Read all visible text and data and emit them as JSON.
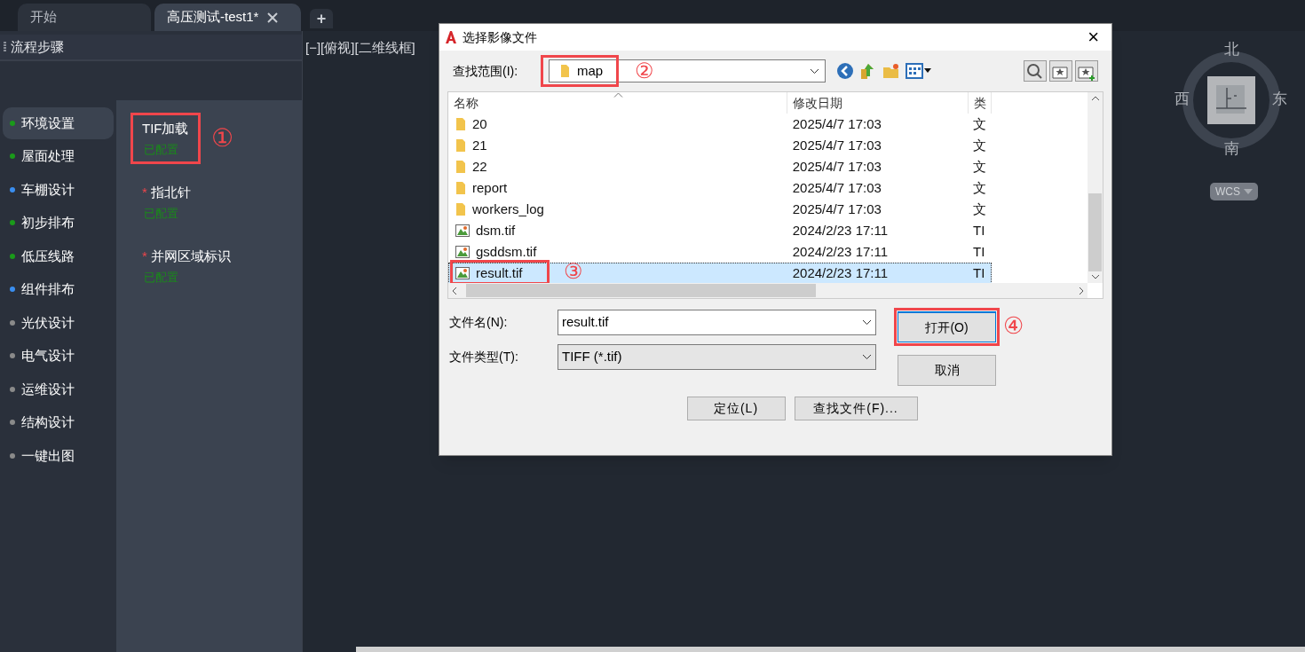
{
  "tabs": [
    {
      "label": "开始",
      "selected": false,
      "closable": false
    },
    {
      "label": "高压测试-test1*",
      "selected": true,
      "closable": true
    }
  ],
  "new_tab": "+",
  "panel": {
    "title": "流程步骤",
    "steps": [
      {
        "label": "环境设置",
        "color": "#1a9a1a",
        "selected": true
      },
      {
        "label": "屋面处理",
        "color": "#1a9a1a",
        "selected": false
      },
      {
        "label": "车棚设计",
        "color": "#3a8ef0",
        "selected": false
      },
      {
        "label": "初步排布",
        "color": "#1a9a1a",
        "selected": false
      },
      {
        "label": "低压线路",
        "color": "#1a9a1a",
        "selected": false
      },
      {
        "label": "组件排布",
        "color": "#3a8ef0",
        "selected": false
      },
      {
        "label": "光伏设计",
        "color": "#8a8a8a",
        "selected": false
      },
      {
        "label": "电气设计",
        "color": "#8a8a8a",
        "selected": false
      },
      {
        "label": "运维设计",
        "color": "#8a8a8a",
        "selected": false
      },
      {
        "label": "结构设计",
        "color": "#8a8a8a",
        "selected": false
      },
      {
        "label": "一键出图",
        "color": "#8a8a8a",
        "selected": false
      }
    ],
    "tasks": [
      {
        "label": "TIF加载",
        "status": "已配置",
        "callout": "①"
      },
      {
        "label": "指北针",
        "mark": "*",
        "status": "已配置"
      },
      {
        "label": "并网区域标识",
        "mark": "*",
        "status": "已配置"
      }
    ]
  },
  "viewport": {
    "label": "[−][俯视][二维线框]",
    "compass": {
      "north": "北",
      "south": "南",
      "east": "东",
      "west": "西",
      "ucs": "WCS"
    }
  },
  "dialog": {
    "title": "选择影像文件",
    "close": "×",
    "look_in": {
      "label": "查找范围(I):",
      "value": "map",
      "callout": "②"
    },
    "columns": [
      "名称",
      "修改日期",
      "类"
    ],
    "files": [
      {
        "kind": "folder",
        "name": "20",
        "date": "2025/4/7 17:03",
        "type": "文",
        "selected": false
      },
      {
        "kind": "folder",
        "name": "21",
        "date": "2025/4/7 17:03",
        "type": "文",
        "selected": false
      },
      {
        "kind": "folder",
        "name": "22",
        "date": "2025/4/7 17:03",
        "type": "文",
        "selected": false
      },
      {
        "kind": "folder",
        "name": "report",
        "date": "2025/4/7 17:03",
        "type": "文",
        "selected": false
      },
      {
        "kind": "folder",
        "name": "workers_log",
        "date": "2025/4/7 17:03",
        "type": "文",
        "selected": false
      },
      {
        "kind": "image",
        "name": "dsm.tif",
        "date": "2024/2/23 17:11",
        "type": "TI",
        "selected": false
      },
      {
        "kind": "image",
        "name": "gsddsm.tif",
        "date": "2024/2/23 17:11",
        "type": "TI",
        "selected": false
      },
      {
        "kind": "image",
        "name": "result.tif",
        "date": "2024/2/23 17:11",
        "type": "TI",
        "selected": true,
        "callout": "③"
      }
    ],
    "file_name": {
      "label": "文件名(N):",
      "value": "result.tif"
    },
    "file_type": {
      "label": "文件类型(T):",
      "value": "TIFF (*.tif)"
    },
    "buttons": [
      {
        "label": "打开(O)",
        "kind": "primary",
        "callout": "④"
      },
      {
        "label": "取消",
        "kind": "normal"
      }
    ],
    "bottom_buttons": [
      "定位(L)",
      "查找文件(F)..."
    ]
  }
}
